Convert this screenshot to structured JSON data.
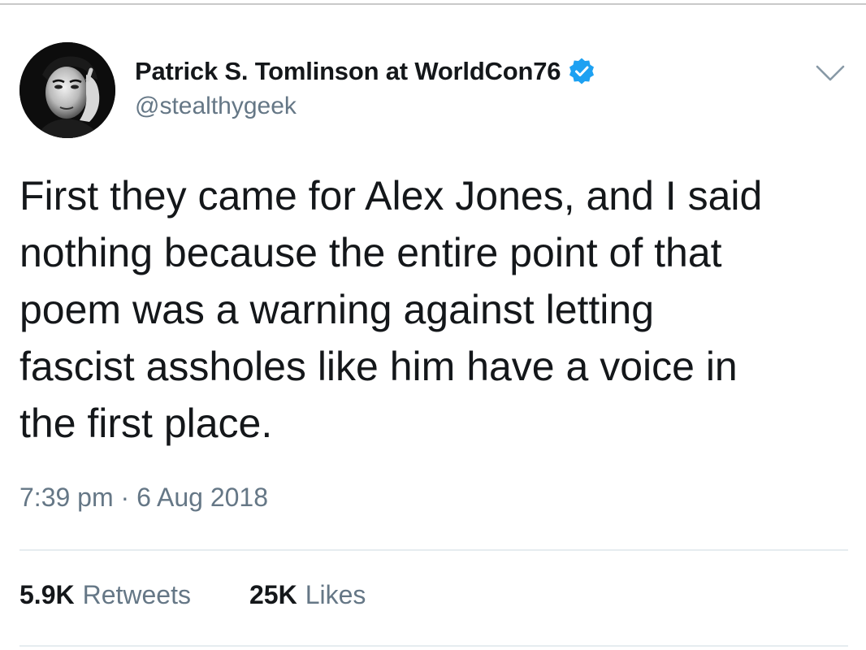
{
  "user": {
    "display_name": "Patrick S. Tomlinson at WorldCon76",
    "handle": "@stealthygeek",
    "verified": true
  },
  "tweet": {
    "text": "First they came for Alex Jones, and I said\nnothing because the entire point of that\npoem was a warning against letting\nfascist assholes like him have a voice in\nthe first place.",
    "time": "7:39 pm",
    "separator": "·",
    "date": "6 Aug 2018"
  },
  "stats": {
    "retweets_count": "5.9K",
    "retweets_label": "Retweets",
    "likes_count": "25K",
    "likes_label": "Likes"
  },
  "icons": {
    "verified": "verified-badge-icon",
    "menu": "chevron-down-icon"
  },
  "colors": {
    "text": "#14171a",
    "secondary": "#657786",
    "verified_blue": "#1da1f2",
    "divider": "#e6ecf0"
  }
}
